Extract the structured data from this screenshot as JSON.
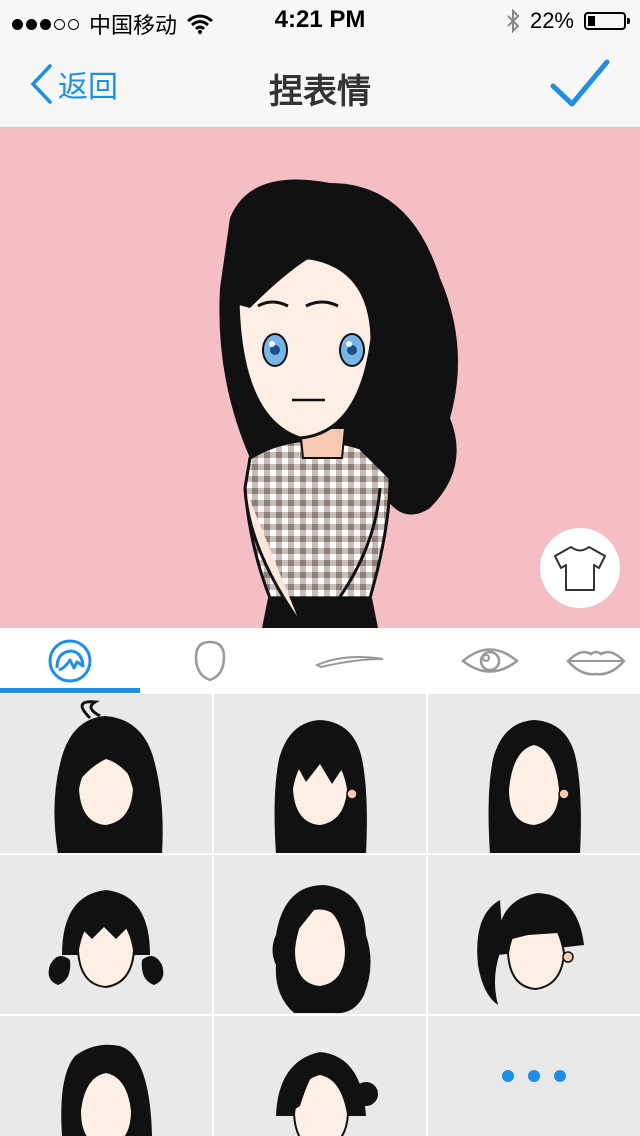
{
  "status_bar": {
    "carrier": "中国移动",
    "time": "4:21 PM",
    "battery_percent": "22%",
    "battery_level": 0.22,
    "signal_bars_filled": 3,
    "signal_bars_total": 5
  },
  "nav": {
    "back_label": "返回",
    "title": "捏表情"
  },
  "colors": {
    "accent": "#1e8fe8",
    "canvas_bg": "#f4bec4",
    "grid_bg": "#e9e9e9"
  },
  "tabs": [
    {
      "name": "hair",
      "icon": "hair-icon",
      "selected": true
    },
    {
      "name": "face",
      "icon": "face-shape-icon",
      "selected": false
    },
    {
      "name": "eyebrows",
      "icon": "eyebrow-icon",
      "selected": false
    },
    {
      "name": "eyes",
      "icon": "eye-icon",
      "selected": false
    },
    {
      "name": "mouth",
      "icon": "lips-icon",
      "selected": false
    }
  ],
  "hair_options": [
    {
      "style": "hair-style-ahoge-long"
    },
    {
      "style": "hair-style-long-straight-bangs"
    },
    {
      "style": "hair-style-long-center-part"
    },
    {
      "style": "hair-style-pigtails-bangs"
    },
    {
      "style": "hair-style-wavy-long"
    },
    {
      "style": "hair-style-side-ponytail"
    },
    {
      "style": "hair-style-bob-side-part"
    },
    {
      "style": "hair-style-updo-side-bun"
    },
    {
      "style": "more-options"
    }
  ]
}
